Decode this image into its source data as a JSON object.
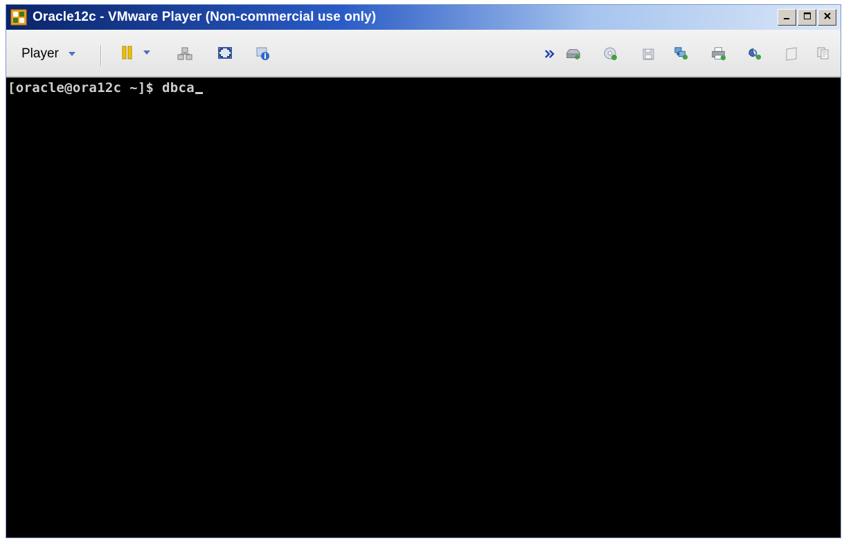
{
  "window": {
    "title": "Oracle12c - VMware Player (Non-commercial use only)",
    "caption_minimize": "minimize-icon",
    "caption_maximize": "maximize-icon",
    "caption_close": "close-icon"
  },
  "toolbar": {
    "player_label": "Player",
    "icons": {
      "pause": "pause-icon",
      "send_ctrl_alt_del": "ctrl-alt-del-icon",
      "fullscreen": "fullscreen-icon",
      "unity": "unity-icon",
      "more": "more-chevron-icon",
      "hard_disk": "hard-disk-icon",
      "cd_dvd": "cd-dvd-icon",
      "floppy": "floppy-icon",
      "network": "network-adapter-icon",
      "printer": "printer-icon",
      "sound": "sound-icon",
      "display": "display-icon",
      "message_log": "message-log-icon"
    }
  },
  "console": {
    "prompt": "[oracle@ora12c ~]$ ",
    "command": "dbca"
  },
  "colors": {
    "title_gradient_start": "#0a246a",
    "title_gradient_end": "#dbe7f7",
    "console_bg": "#000000",
    "console_text": "#cfcfcf",
    "accent_arrow": "#4b6fc4"
  }
}
